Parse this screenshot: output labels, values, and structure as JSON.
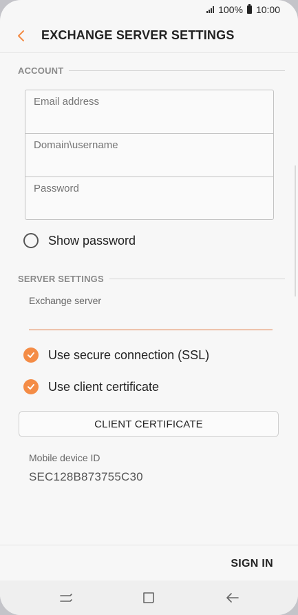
{
  "status_bar": {
    "battery": "100%",
    "time": "10:00"
  },
  "header": {
    "title": "EXCHANGE SERVER SETTINGS"
  },
  "account": {
    "section_label": "ACCOUNT",
    "email": {
      "value": "",
      "placeholder": "Email address"
    },
    "username": {
      "value": "",
      "placeholder": "Domain\\username"
    },
    "password": {
      "value": "",
      "placeholder": "Password"
    },
    "show_password": {
      "label": "Show password",
      "checked": false
    }
  },
  "server": {
    "section_label": "SERVER SETTINGS",
    "exchange_label": "Exchange server",
    "exchange_value": "",
    "ssl": {
      "label": "Use secure connection (SSL)",
      "checked": true
    },
    "client_cert": {
      "label": "Use client certificate",
      "checked": true
    },
    "cert_button": "CLIENT CERTIFICATE",
    "device_id_label": "Mobile device ID",
    "device_id": "SEC128B873755C30"
  },
  "footer": {
    "sign_in": "SIGN IN"
  },
  "colors": {
    "accent": "#f48c46",
    "underline": "#e0743a"
  },
  "icons": {
    "back": "chevron-left-icon",
    "nav": [
      "recents-icon",
      "home-icon",
      "back-arrow-icon"
    ]
  }
}
